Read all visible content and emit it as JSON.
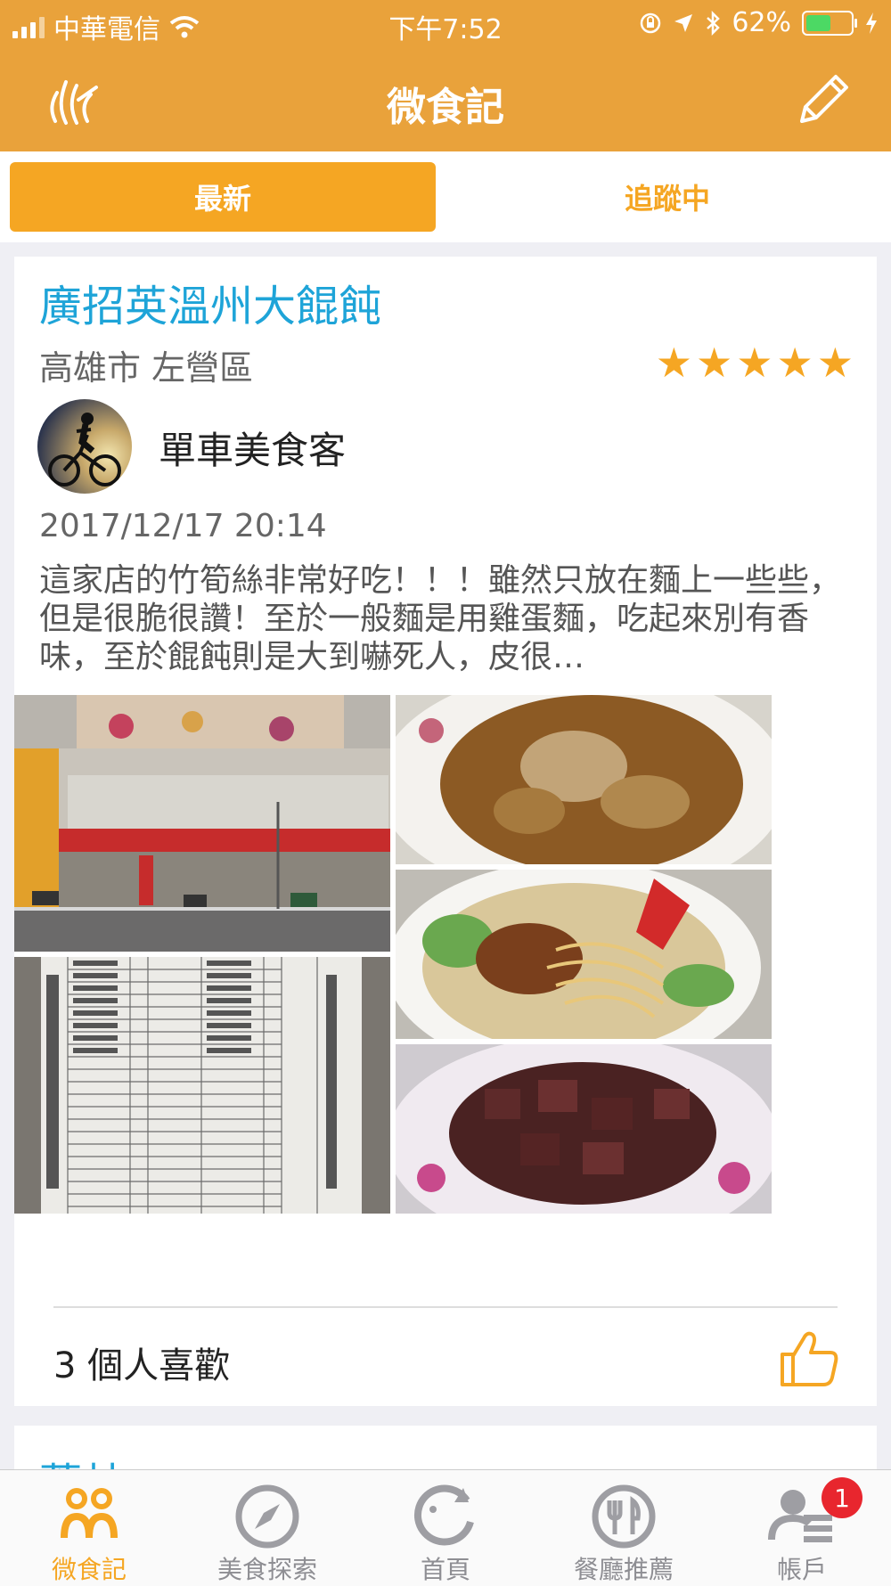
{
  "status_bar": {
    "carrier": "中華電信",
    "time": "下午7:52",
    "battery": "62%",
    "battery_level": 0.62
  },
  "header": {
    "title": "微食記",
    "left_icon": "hand-icon",
    "right_icon": "pencil-icon"
  },
  "tabs": [
    {
      "label": "最新",
      "active": true
    },
    {
      "label": "追蹤中",
      "active": false
    }
  ],
  "post": {
    "restaurant": "廣招英溫州大餛飩",
    "location": "高雄市 左營區",
    "rating": 5,
    "author": "單車美食客",
    "date": "2017/12/17 20:14",
    "text": "這家店的竹筍絲非常好吃！！！雖然只放在麵上一些些，但是很脆很讚！至於一般麵是用雞蛋麵，吃起來別有香味，至於餛飩則是大到嚇死人，皮很…",
    "likes": "3 個人喜歡"
  },
  "next_post": {
    "restaurant": "蔥林"
  },
  "bottom_tabs": [
    {
      "label": "微食記",
      "icon": "people-icon",
      "active": true
    },
    {
      "label": "美食探索",
      "icon": "compass-icon",
      "active": false
    },
    {
      "label": "首頁",
      "icon": "home-refresh-icon",
      "active": false
    },
    {
      "label": "餐廳推薦",
      "icon": "fork-knife-icon",
      "active": false
    },
    {
      "label": "帳戶",
      "icon": "account-icon",
      "active": false,
      "badge": "1"
    }
  ],
  "colors": {
    "primary": "#e9a23b",
    "accent": "#f5a623",
    "title_blue": "#1ea4d8",
    "badge_red": "#e8262e"
  }
}
